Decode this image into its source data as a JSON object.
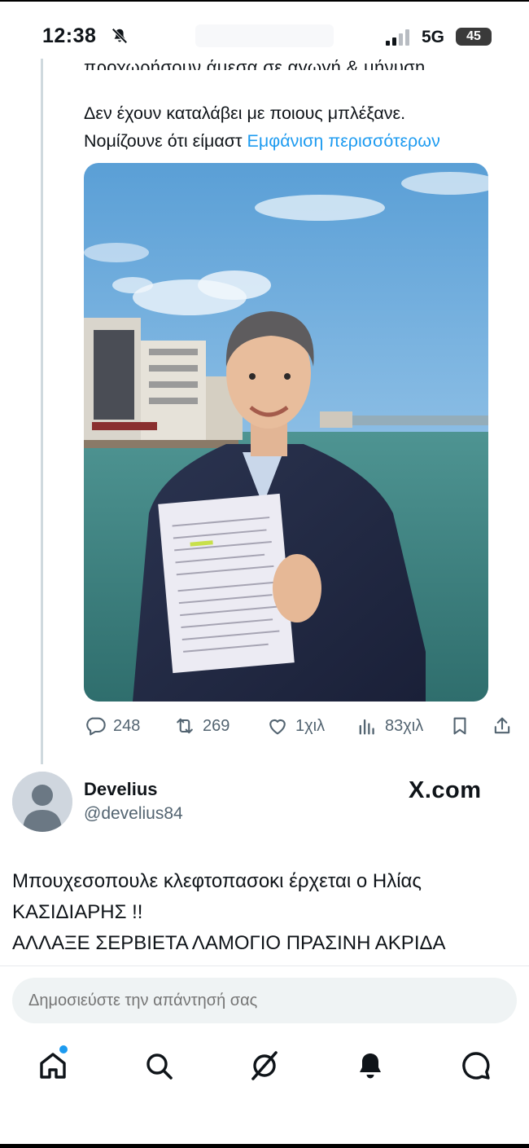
{
  "status_bar": {
    "time": "12:38",
    "network": "5G",
    "battery": "45",
    "icons": [
      "bell-off-icon",
      "signal-icon"
    ]
  },
  "tweet": {
    "clipped_line": "προχωρήσουν άμεσα σε αγωγή & μήνυση.",
    "text_line1": "Δεν έχουν καταλάβει με ποιους μπλέξανε.",
    "text_line2": "Νομίζουνε ότι είμαστ ",
    "show_more": "Εμφάνιση περισσότερων",
    "actions": {
      "replies": "248",
      "retweets": "269",
      "likes": "1χιλ",
      "views": "83χιλ"
    }
  },
  "reply": {
    "display_name": "Develius",
    "handle": "@develius84",
    "source": "X.com",
    "lines": [
      "Μπουχεσοπουλε κλεφτοπασοκι έρχεται ο Ηλίας",
      "ΚΑΣΙΔΙΑΡΗΣ !!",
      "ΑΛΛΑΞΕ ΣΕΡΒΙΕΤΑ ΛΑΜΟΓΙΟ ΠΡΑΣΙΝΗ ΑΚΡΙΔΑ"
    ]
  },
  "compose": {
    "placeholder": "Δημοσιεύστε την απάντησή σας"
  },
  "nav": [
    "home-icon",
    "search-icon",
    "grok-icon",
    "notifications-icon",
    "messages-icon"
  ],
  "colors": {
    "accent": "#1d9bf0",
    "text": "#0f1419",
    "secondary": "#536471"
  }
}
